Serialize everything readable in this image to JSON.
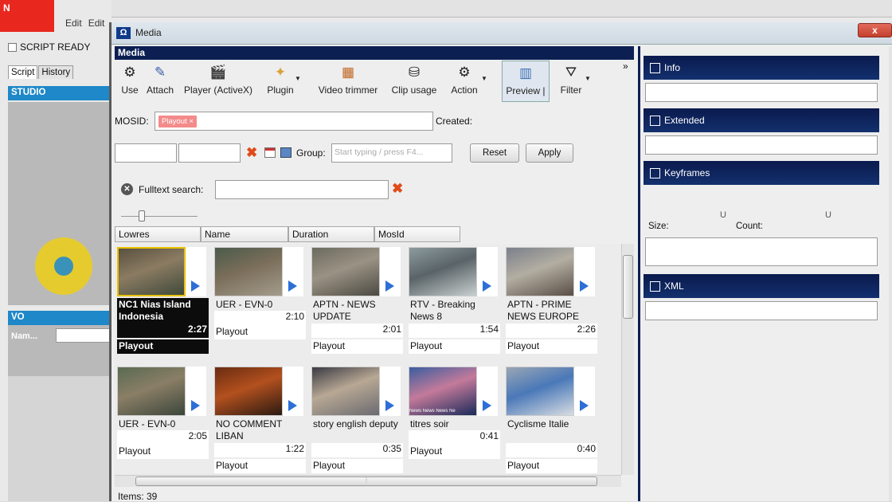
{
  "bg_app": {
    "logo": "N",
    "menu": [
      "Edit",
      "Edit"
    ],
    "script_ready": "SCRIPT READY",
    "tabs": [
      "Script",
      "History"
    ],
    "studio": "STUDIO",
    "vo": "VO",
    "vo_name_label": "Nam..."
  },
  "window": {
    "title": "Media",
    "title_icon": "Ω",
    "close_label": "x"
  },
  "media_header": "Media",
  "toolbar": {
    "items": [
      {
        "label": "Use",
        "icon": "gears-icon"
      },
      {
        "label": "Attach",
        "icon": "paperclip-icon"
      },
      {
        "label": "Player (ActiveX)",
        "icon": "clapperboard-icon"
      },
      {
        "label": "Plugin",
        "icon": "plugin-icon"
      },
      {
        "label": "Video trimmer",
        "icon": "film-icon"
      },
      {
        "label": "Clip usage",
        "icon": "clip-usage-icon"
      },
      {
        "label": "Action",
        "icon": "action-gears-icon"
      },
      {
        "label": "Preview |",
        "icon": "preview-icon"
      },
      {
        "label": "Filter",
        "icon": "filter-icon"
      }
    ],
    "more": "»"
  },
  "mosid": {
    "label": "MOSID:",
    "tag": "Playout",
    "tag_remove": "×",
    "created_label": "Created:"
  },
  "group_row": {
    "clear": "✖",
    "group_label": "Group:",
    "group_placeholder": "Start typing / press F4...",
    "reset_label": "Reset",
    "apply_label": "Apply"
  },
  "fulltext": {
    "label": "Fulltext search:",
    "clear": "✖"
  },
  "columns": [
    "Lowres",
    "Name",
    "Duration",
    "MosId"
  ],
  "clips": [
    {
      "title": "NC1 Nias Island Indonesia",
      "duration": "2:27",
      "status": "Playout",
      "selected": true,
      "colors": [
        "#5a5140",
        "#8b7b62",
        "#3f4a3a"
      ]
    },
    {
      "title": "UER - EVN-0",
      "duration": "2:10",
      "status": "Playout",
      "colors": [
        "#4b5a4a",
        "#7a6e5a",
        "#a49c8c"
      ]
    },
    {
      "title": "APTN - NEWS UPDATE",
      "duration": "2:01",
      "status": "Playout",
      "colors": [
        "#6b6a5e",
        "#9a9284",
        "#4c4a42"
      ]
    },
    {
      "title": "RTV - Breaking News 8",
      "duration": "1:54",
      "status": "Playout",
      "colors": [
        "#8c9a9e",
        "#5a6468",
        "#c9cfd0"
      ]
    },
    {
      "title": "APTN - PRIME NEWS EUROPE",
      "duration": "2:26",
      "status": "Playout",
      "colors": [
        "#7a7f8a",
        "#b3aea2",
        "#5a4e46"
      ]
    },
    {
      "title": "UER - EVN-0",
      "duration": "2:05",
      "status": "Playout",
      "colors": [
        "#5a6a52",
        "#8a7e66",
        "#3c463a"
      ]
    },
    {
      "title": "NO COMMENT LIBAN",
      "duration": "1:22",
      "status": "Playout",
      "colors": [
        "#6a2c12",
        "#b3501e",
        "#2a1a12"
      ]
    },
    {
      "title": "story english deputy",
      "duration": "0:35",
      "status": "Playout",
      "colors": [
        "#3a3a44",
        "#b8a894",
        "#6a6a70"
      ]
    },
    {
      "title": "titres soir",
      "duration": "0:41",
      "status": "Playout",
      "thumb_text": "News  News  News  Ne",
      "colors": [
        "#3a5ea0",
        "#c47a9a",
        "#1a2a5a"
      ]
    },
    {
      "title": "Cyclisme Italie",
      "duration": "0:40",
      "status": "Playout",
      "colors": [
        "#9aa6b4",
        "#4a78b8",
        "#d8dde2"
      ]
    }
  ],
  "items_count": "Items: 39",
  "right_panel": {
    "sections": [
      "Info",
      "Extended",
      "Keyframes",
      "XML"
    ],
    "size_label": "Size:",
    "count_label": "Count:",
    "slider_mark": "U"
  }
}
